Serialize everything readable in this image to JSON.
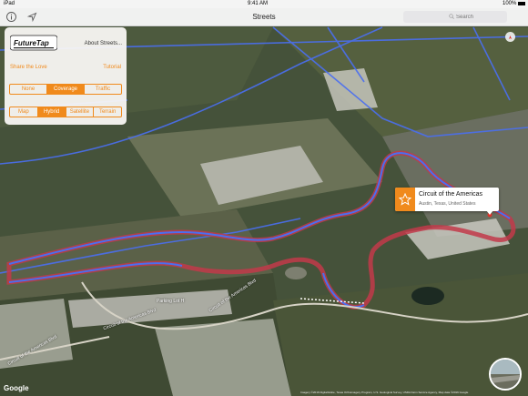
{
  "status_bar": {
    "device": "iPad",
    "time": "9:41 AM",
    "battery": "100%"
  },
  "nav": {
    "title": "Streets",
    "search_placeholder": "Search",
    "info_icon": "info-icon",
    "location_icon": "location-arrow-icon"
  },
  "panel": {
    "about_label": "About Streets...",
    "share_label": "Share the Love",
    "tutorial_label": "Tutorial",
    "overlay_options": [
      "None",
      "Coverage",
      "Traffic"
    ],
    "overlay_selected": "Coverage",
    "map_type_options": [
      "Map",
      "Hybrid",
      "Satellite",
      "Terrain"
    ],
    "map_type_selected": "Hybrid"
  },
  "callout": {
    "title": "Circuit of the Americas",
    "subtitle": "Austin, Texas, United States",
    "icon": "star-icon"
  },
  "map_labels": {
    "road_1": "Circuit of the Americas Blvd",
    "road_2": "Circuit of the Americas Blvd",
    "road_3": "Circuit of the Americas Blvd",
    "parking": "Parking Lot H",
    "pit_label": "Parking Lot H"
  },
  "footer": {
    "google": "Google",
    "credit": "Imagery ©2016 DigitalGlobe, Texas Orthoimagery Program, U.S. Geological Survey, USDA Farm Service Agency, Map data ©2016 Google"
  },
  "colors": {
    "accent": "#f08a1c",
    "coverage": "#4a6ff0",
    "track": "#c23a4a"
  }
}
